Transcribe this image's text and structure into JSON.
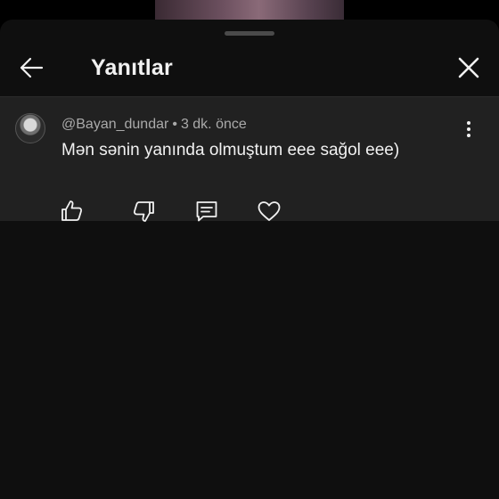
{
  "header": {
    "title": "Yanıtlar"
  },
  "comment": {
    "author": "@Bayan_dundar",
    "separator": "•",
    "time": "3 dk. önce",
    "text": "Mən sənin yanında olmuştum eee sağol eee)"
  },
  "icons": {
    "back": "arrow-left-icon",
    "close": "close-icon",
    "more": "more-vertical-icon",
    "like": "thumb-up-icon",
    "dislike": "thumb-down-icon",
    "reply": "comment-icon",
    "heart": "heart-icon"
  },
  "colors": {
    "sheet_bg": "#0f0f0f",
    "comment_bg": "#212121",
    "text_primary": "#f1f1f1",
    "text_secondary": "#aaaaaa"
  }
}
